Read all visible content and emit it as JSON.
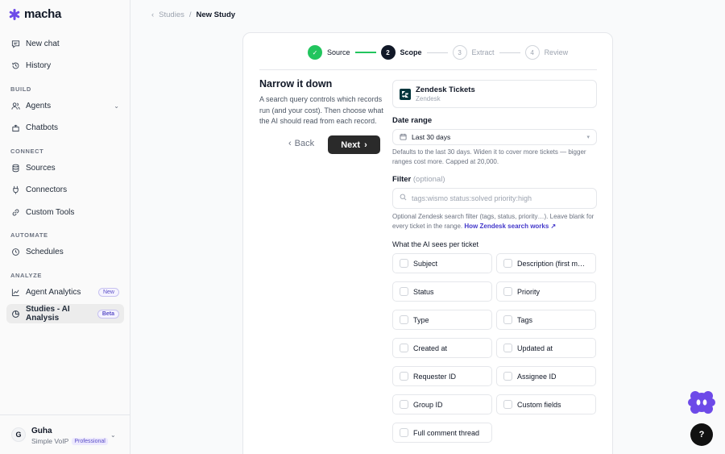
{
  "brand": {
    "name": "macha",
    "color": "#6d4ae8"
  },
  "sidebar": {
    "top": [
      {
        "label": "New chat",
        "icon": "chat-icon"
      },
      {
        "label": "History",
        "icon": "history-icon"
      }
    ],
    "sections": [
      {
        "label": "BUILD",
        "items": [
          {
            "label": "Agents",
            "icon": "agents-icon"
          },
          {
            "label": "Chatbots",
            "icon": "chatbots-icon"
          }
        ]
      },
      {
        "label": "CONNECT",
        "items": [
          {
            "label": "Sources",
            "icon": "database-icon"
          },
          {
            "label": "Connectors",
            "icon": "plug-icon"
          },
          {
            "label": "Custom Tools",
            "icon": "link-icon"
          }
        ]
      },
      {
        "label": "AUTOMATE",
        "items": [
          {
            "label": "Schedules",
            "icon": "clock-icon"
          }
        ]
      },
      {
        "label": "ANALYZE",
        "items": [
          {
            "label": "Agent Analytics",
            "icon": "chart-icon",
            "badge": "New"
          },
          {
            "label": "Studies - AI Analysis",
            "icon": "pie-icon",
            "badge": "Beta",
            "active": true
          }
        ]
      }
    ],
    "user": {
      "initial": "G",
      "name": "Guha",
      "org": "Simple VoIP",
      "plan": "Professional"
    }
  },
  "breadcrumb": {
    "parent": "Studies",
    "current": "New Study"
  },
  "stepper": [
    {
      "num": "✓",
      "label": "Source",
      "state": "done"
    },
    {
      "num": "2",
      "label": "Scope",
      "state": "current"
    },
    {
      "num": "3",
      "label": "Extract",
      "state": "todo"
    },
    {
      "num": "4",
      "label": "Review",
      "state": "todo"
    }
  ],
  "left": {
    "title": "Narrow it down",
    "desc": "A search query controls which records run (and your cost). Then choose what the AI should read from each record.",
    "back": "Back",
    "next": "Next"
  },
  "source": {
    "name": "Zendesk Tickets",
    "sub": "Zendesk"
  },
  "date_range": {
    "label": "Date range",
    "value": "Last 30 days",
    "hint": "Defaults to the last 30 days. Widen it to cover more tickets — bigger ranges cost more. Capped at 20,000."
  },
  "filter": {
    "label": "Filter",
    "optional": "(optional)",
    "placeholder": "tags:wismo status:solved priority:high",
    "hint": "Optional Zendesk search filter (tags, status, priority…). Leave blank for every ticket in the range.",
    "link": "How Zendesk search works ↗"
  },
  "fields": {
    "label": "What the AI sees per ticket",
    "items": [
      "Subject",
      "Description (first mes...",
      "Status",
      "Priority",
      "Type",
      "Tags",
      "Created at",
      "Updated at",
      "Requester ID",
      "Assignee ID",
      "Group ID",
      "Custom fields",
      "Full comment thread"
    ]
  },
  "help_label": "?"
}
